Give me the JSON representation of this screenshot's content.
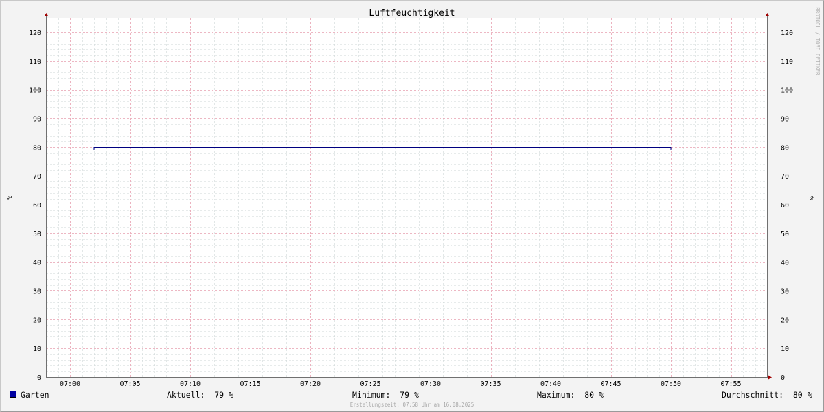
{
  "chart_data": {
    "type": "line",
    "title": "Luftfeuchtigkeit",
    "ylabel": "%",
    "ylabel_right": "%",
    "ylim": [
      0,
      125
    ],
    "yticks": [
      0,
      10,
      20,
      30,
      40,
      50,
      60,
      70,
      80,
      90,
      100,
      110,
      120
    ],
    "x_start": "06:58",
    "x_end": "07:58",
    "xticks": [
      "07:00",
      "07:05",
      "07:10",
      "07:15",
      "07:20",
      "07:25",
      "07:30",
      "07:35",
      "07:40",
      "07:45",
      "07:50",
      "07:55"
    ],
    "grid": true,
    "series": [
      {
        "name": "Garten",
        "color": "#000080",
        "points": [
          {
            "t": "06:58",
            "v": 79
          },
          {
            "t": "07:02",
            "v": 79
          },
          {
            "t": "07:02",
            "v": 80
          },
          {
            "t": "07:50",
            "v": 80
          },
          {
            "t": "07:50",
            "v": 79
          },
          {
            "t": "07:58",
            "v": 79
          }
        ]
      }
    ],
    "legend": {
      "placement": "bottom",
      "series_name": "Garten",
      "swatch_color": "#0000a0",
      "aktuell": "Aktuell:  79 %",
      "minimum": "Minimum:  79 %",
      "maximum": "Maximum:  80 %",
      "durchschnitt": "Durchschnitt:  80 %"
    },
    "watermark": "RRDTOOL / TOBI OETIKER",
    "footer": "Erstellungszeit: 07:58 Uhr am 16.08.2025",
    "colors": {
      "background": "#f3f3f3",
      "plot_background": "#ffffff",
      "major_grid": "#e8a0b0",
      "minor_grid": "#cfd8d8",
      "axis": "#707070",
      "arrow": "#a00000"
    }
  }
}
